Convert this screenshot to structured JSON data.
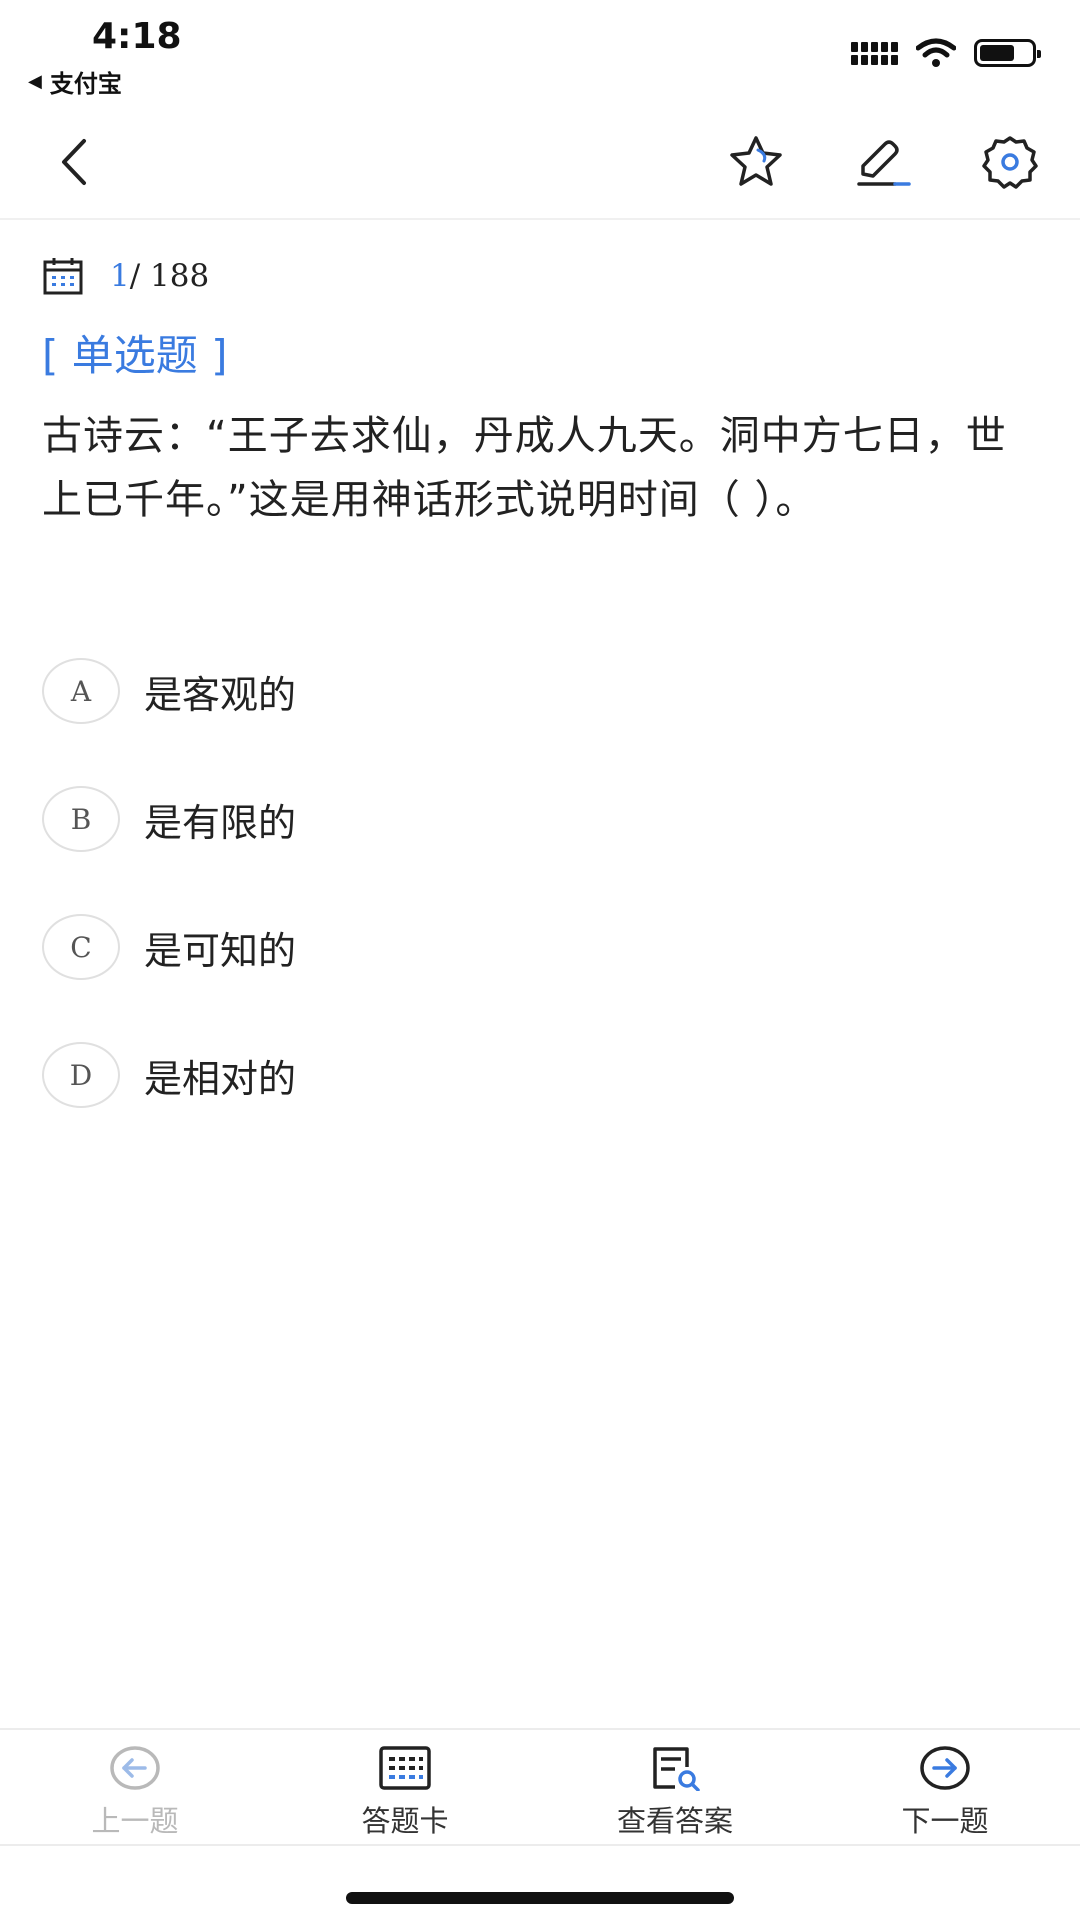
{
  "status_bar": {
    "time": "4:18",
    "back_app": "支付宝",
    "back_glyph": "◀"
  },
  "nav": {
    "back_icon": "chevron-left-icon",
    "favorite_icon": "star-icon",
    "edit_icon": "edit-icon",
    "settings_icon": "gear-icon"
  },
  "progress": {
    "current": "1",
    "separator_total": "/ 188"
  },
  "question": {
    "type_label": "[ 单选题 ]",
    "text": "古诗云：“王子去求仙，丹成人九天。洞中方七日，世上已千年。”这是用神话形式说明时间（ ）。"
  },
  "options": [
    {
      "letter": "A",
      "text": "是客观的"
    },
    {
      "letter": "B",
      "text": "是有限的"
    },
    {
      "letter": "C",
      "text": "是可知的"
    },
    {
      "letter": "D",
      "text": "是相对的"
    }
  ],
  "bottom_tabs": {
    "prev": "上一题",
    "answer_card": "答题卡",
    "view_answer": "查看答案",
    "next": "下一题"
  },
  "colors": {
    "accent": "#3a7be0",
    "text": "#222222",
    "disabled": "#b9b9b9",
    "border": "#e0e0e0"
  }
}
